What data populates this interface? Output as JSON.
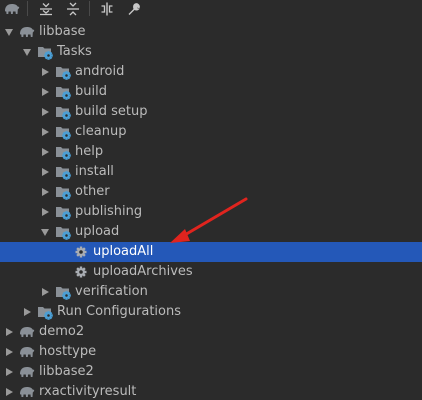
{
  "toolbar": {
    "icons": [
      "gradle-elephant-icon",
      "expand-all-icon",
      "collapse-all-icon",
      "link-icon",
      "wrench-icon"
    ]
  },
  "colors": {
    "background": "#2b2b2b",
    "selection": "#2458b8",
    "text": "#bbbbbb",
    "folder": "#8a9097",
    "gear_badge": "#4a9fd6",
    "annotation_arrow": "#e0241e"
  },
  "tree": [
    {
      "label": "libbase",
      "depth": 0,
      "kind": "project",
      "state": "expanded"
    },
    {
      "label": "Tasks",
      "depth": 1,
      "kind": "folder",
      "state": "expanded"
    },
    {
      "label": "android",
      "depth": 2,
      "kind": "folder",
      "state": "collapsed"
    },
    {
      "label": "build",
      "depth": 2,
      "kind": "folder",
      "state": "collapsed"
    },
    {
      "label": "build setup",
      "depth": 2,
      "kind": "folder",
      "state": "collapsed"
    },
    {
      "label": "cleanup",
      "depth": 2,
      "kind": "folder",
      "state": "collapsed"
    },
    {
      "label": "help",
      "depth": 2,
      "kind": "folder",
      "state": "collapsed"
    },
    {
      "label": "install",
      "depth": 2,
      "kind": "folder",
      "state": "collapsed"
    },
    {
      "label": "other",
      "depth": 2,
      "kind": "folder",
      "state": "collapsed"
    },
    {
      "label": "publishing",
      "depth": 2,
      "kind": "folder",
      "state": "collapsed"
    },
    {
      "label": "upload",
      "depth": 2,
      "kind": "folder",
      "state": "expanded"
    },
    {
      "label": "uploadAll",
      "depth": 3,
      "kind": "task",
      "state": "leaf",
      "selected": true
    },
    {
      "label": "uploadArchives",
      "depth": 3,
      "kind": "task",
      "state": "leaf"
    },
    {
      "label": "verification",
      "depth": 2,
      "kind": "folder",
      "state": "collapsed"
    },
    {
      "label": "Run Configurations",
      "depth": 1,
      "kind": "folder",
      "state": "collapsed"
    },
    {
      "label": "demo2",
      "depth": 0,
      "kind": "project",
      "state": "collapsed"
    },
    {
      "label": "hosttype",
      "depth": 0,
      "kind": "project",
      "state": "collapsed"
    },
    {
      "label": "libbase2",
      "depth": 0,
      "kind": "project",
      "state": "collapsed"
    },
    {
      "label": "rxactivityresult",
      "depth": 0,
      "kind": "project",
      "state": "collapsed"
    }
  ]
}
